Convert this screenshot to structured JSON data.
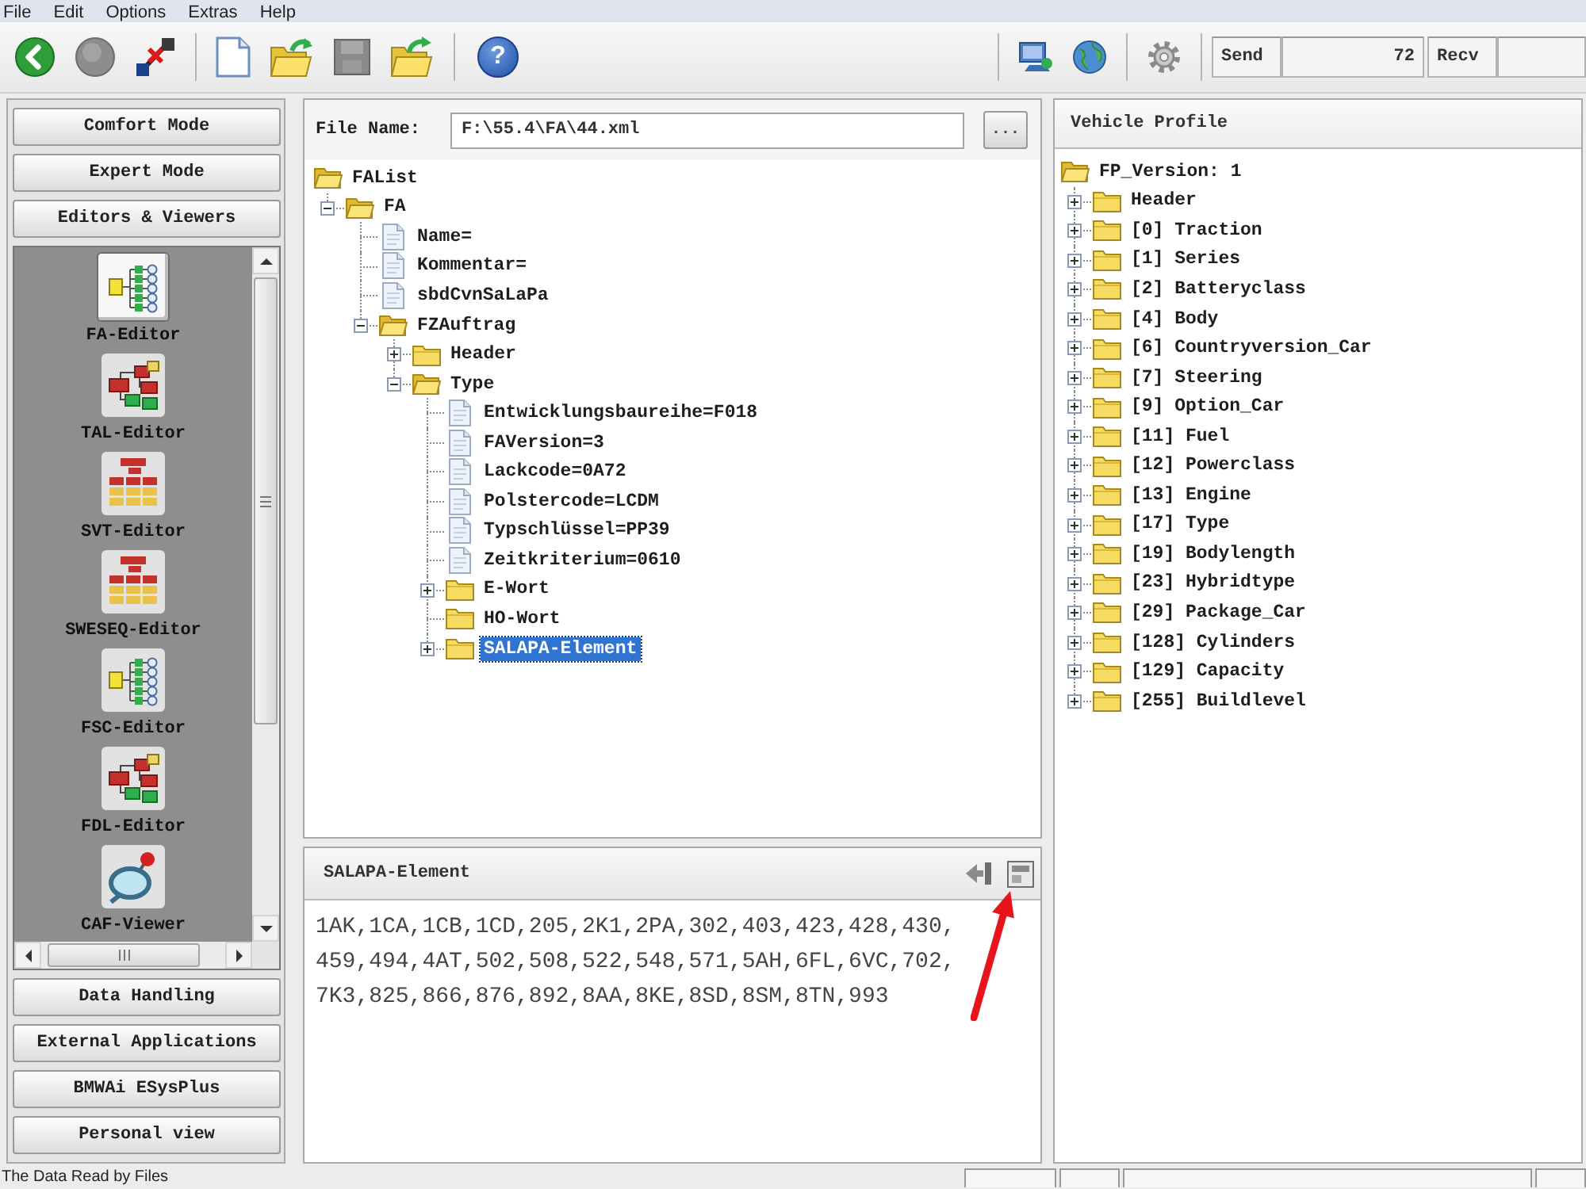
{
  "menu_bar": [
    {
      "label": "File"
    },
    {
      "label": "Edit"
    },
    {
      "label": "Options"
    },
    {
      "label": "Extras"
    },
    {
      "label": "Help"
    }
  ],
  "toolbar": {
    "help_glyph": "?",
    "counters": [
      {
        "label": "Send",
        "value": "72"
      },
      {
        "label": "Recv"
      }
    ]
  },
  "sidebar": {
    "top_buttons": [
      "Comfort Mode",
      "Expert Mode",
      "Editors & Viewers"
    ],
    "tools": [
      {
        "label": "FA-Editor",
        "kind": "list",
        "selected": true
      },
      {
        "label": "TAL-Editor",
        "kind": "branch",
        "selected": false
      },
      {
        "label": "SVT-Editor",
        "kind": "stack",
        "selected": false
      },
      {
        "label": "SWESEQ-Editor",
        "kind": "stack",
        "selected": false
      },
      {
        "label": "FSC-Editor",
        "kind": "list",
        "selected": false
      },
      {
        "label": "FDL-Editor",
        "kind": "branch",
        "selected": false
      },
      {
        "label": "CAF-Viewer",
        "kind": "magnifier",
        "selected": false
      }
    ],
    "bottom_buttons": [
      "Data Handling",
      "External Applications",
      "BMWAi ESysPlus",
      "Personal view"
    ]
  },
  "file_tree": {
    "file_name": {
      "label": "File Name:",
      "value": "F:\\55.4\\FA\\44.xml",
      "browse": "..."
    },
    "root": {
      "label": "FAList",
      "kind": "folder",
      "selected": false,
      "children": [
        {
          "label": "FA",
          "kind": "folder",
          "expanded": true,
          "selected": false,
          "children": [
            {
              "label": "Name=",
              "kind": "file",
              "selected": false
            },
            {
              "label": "Kommentar=",
              "kind": "file",
              "selected": false
            },
            {
              "label": "sbdCvnSaLaPa",
              "kind": "file",
              "selected": false
            },
            {
              "label": "FZAuftrag",
              "kind": "folder",
              "expanded": true,
              "selected": false,
              "children": [
                {
                  "label": "Header",
                  "kind": "folder",
                  "expanded": false,
                  "selected": false
                },
                {
                  "label": "Type",
                  "kind": "folder",
                  "expanded": true,
                  "selected": false,
                  "children": [
                    {
                      "label": "Entwicklungsbaureihe=F018",
                      "kind": "file",
                      "selected": false
                    },
                    {
                      "label": "FAVersion=3",
                      "kind": "file",
                      "selected": false
                    },
                    {
                      "label": "Lackcode=0A72",
                      "kind": "file",
                      "selected": false
                    },
                    {
                      "label": "Polstercode=LCDM",
                      "kind": "file",
                      "selected": false
                    },
                    {
                      "label": "Typschlüssel=PP39",
                      "kind": "file",
                      "selected": false
                    },
                    {
                      "label": "Zeitkriterium=0610",
                      "kind": "file",
                      "selected": false
                    },
                    {
                      "label": "E-Wort",
                      "kind": "folder",
                      "expanded": false,
                      "selected": false
                    },
                    {
                      "label": "HO-Wort",
                      "kind": "folder",
                      "selected": false
                    },
                    {
                      "label": "SALAPA-Element",
                      "kind": "folder",
                      "expanded": false,
                      "selected": true
                    }
                  ]
                }
              ]
            }
          ]
        }
      ]
    }
  },
  "vehicle_profile": {
    "title": "Vehicle Profile",
    "root": {
      "label": "FP_Version: 1",
      "kind": "folder",
      "selected": false,
      "children": [
        {
          "label": "Header",
          "kind": "folder",
          "expanded": false,
          "selected": false
        },
        {
          "label": "[0] Traction",
          "kind": "folder",
          "expanded": false,
          "selected": false
        },
        {
          "label": "[1] Series",
          "kind": "folder",
          "expanded": false,
          "selected": false
        },
        {
          "label": "[2] Batteryclass",
          "kind": "folder",
          "expanded": false,
          "selected": false
        },
        {
          "label": "[4] Body",
          "kind": "folder",
          "expanded": false,
          "selected": false
        },
        {
          "label": "[6] Countryversion_Car",
          "kind": "folder",
          "expanded": false,
          "selected": false
        },
        {
          "label": "[7] Steering",
          "kind": "folder",
          "expanded": false,
          "selected": false
        },
        {
          "label": "[9] Option_Car",
          "kind": "folder",
          "expanded": false,
          "selected": false
        },
        {
          "label": "[11] Fuel",
          "kind": "folder",
          "expanded": false,
          "selected": false
        },
        {
          "label": "[12] Powerclass",
          "kind": "folder",
          "expanded": false,
          "selected": false
        },
        {
          "label": "[13] Engine",
          "kind": "folder",
          "expanded": false,
          "selected": false
        },
        {
          "label": "[17] Type",
          "kind": "folder",
          "expanded": false,
          "selected": false
        },
        {
          "label": "[19] Bodylength",
          "kind": "folder",
          "expanded": false,
          "selected": false
        },
        {
          "label": "[23] Hybridtype",
          "kind": "folder",
          "expanded": false,
          "selected": false
        },
        {
          "label": "[29] Package_Car",
          "kind": "folder",
          "expanded": false,
          "selected": false
        },
        {
          "label": "[128] Cylinders",
          "kind": "folder",
          "expanded": false,
          "selected": false
        },
        {
          "label": "[129] Capacity",
          "kind": "folder",
          "expanded": false,
          "selected": false
        },
        {
          "label": "[255] Buildlevel",
          "kind": "folder",
          "expanded": false,
          "selected": false
        }
      ]
    }
  },
  "detail_panel": {
    "title": "SALAPA-Element",
    "text": "1AK,1CA,1CB,1CD,205,2K1,2PA,302,403,423,428,430,459,494,4AT,502,508,522,548,571,5AH,6FL,6VC,702,7K3,825,866,876,892,8AA,8KE,8SD,8SM,8TN,993"
  },
  "status_bar": {
    "message": "The Data Read by Files"
  }
}
